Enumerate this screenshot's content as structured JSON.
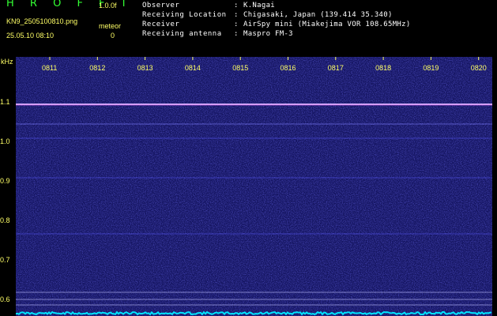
{
  "header": {
    "brand": "H R O F F T",
    "version": "1.0.0f",
    "filename": "KN9_2505100810.png",
    "meteor_label": "meteor",
    "datetime": "25.05.10 08:10",
    "meteor_count": "0"
  },
  "metadata": [
    {
      "label": "Observer",
      "value": "K.Nagai"
    },
    {
      "label": "Receiving Location",
      "value": "Chigasaki, Japan (139.414 35.340)"
    },
    {
      "label": "Receiver",
      "value": "AirSpy mini (Miakejima VOR 108.65MHz)"
    },
    {
      "label": "Receiving antenna",
      "value": "Maspro FM-3"
    }
  ],
  "spectrogram": {
    "y_unit": "kHz",
    "y_ticks": [
      "1.1",
      "1.0",
      "0.9",
      "0.8",
      "0.7",
      "0.6"
    ],
    "time_ticks": [
      "0811",
      "0812",
      "0813",
      "0814",
      "0815",
      "0816",
      "0817",
      "0818",
      "0819",
      "0820"
    ],
    "colors": {
      "background": "#1a1a6e",
      "carrier": "#c8a0ff",
      "baseline": "#00e5ff",
      "labels": "#ffff66"
    }
  }
}
